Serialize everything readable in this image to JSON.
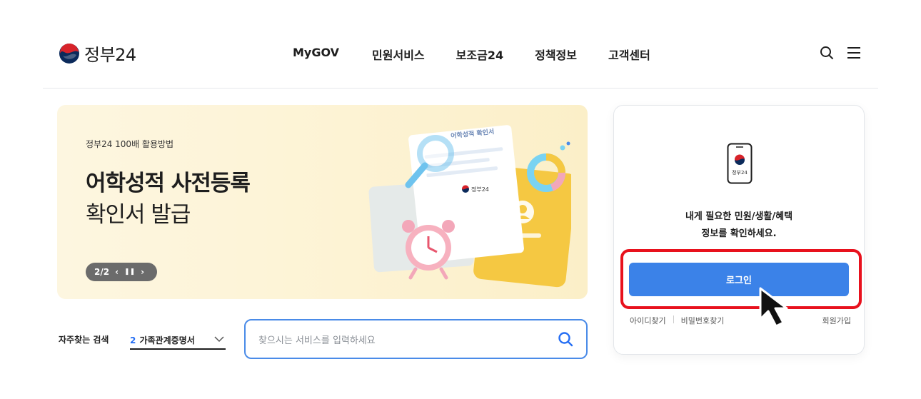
{
  "header": {
    "logo_text": "정부24",
    "nav": [
      "MyGOV",
      "민원서비스",
      "보조금24",
      "정책정보",
      "고객센터"
    ],
    "icons": [
      "search-icon",
      "menu-icon"
    ]
  },
  "banner": {
    "eyebrow": "정부24 100배 활용방법",
    "title_line1": "어학성적 사전등록",
    "title_line2": "확인서 발급",
    "pager": "2/2",
    "document_title": "어학성적 확인서",
    "document_logo": "정부24",
    "colors": {
      "background": "#fdf6e0",
      "accent": "#f5c842"
    }
  },
  "search_row": {
    "label": "자주찾는 검색",
    "select_num": "2",
    "select_text": "가족관계증명서",
    "placeholder": "찾으시는 서비스를 입력하세요"
  },
  "login_card": {
    "phone_label": "정부24",
    "message_line1": "내게 필요한 민원/생활/혜택",
    "message_line2": "정보를 확인하세요.",
    "login_button": "로그인",
    "link_find_id": "아이디찾기",
    "link_find_pw": "비밀번호찾기",
    "link_signup": "회원가입",
    "colors": {
      "button": "#3b82e8",
      "highlight": "#e8111d"
    }
  }
}
